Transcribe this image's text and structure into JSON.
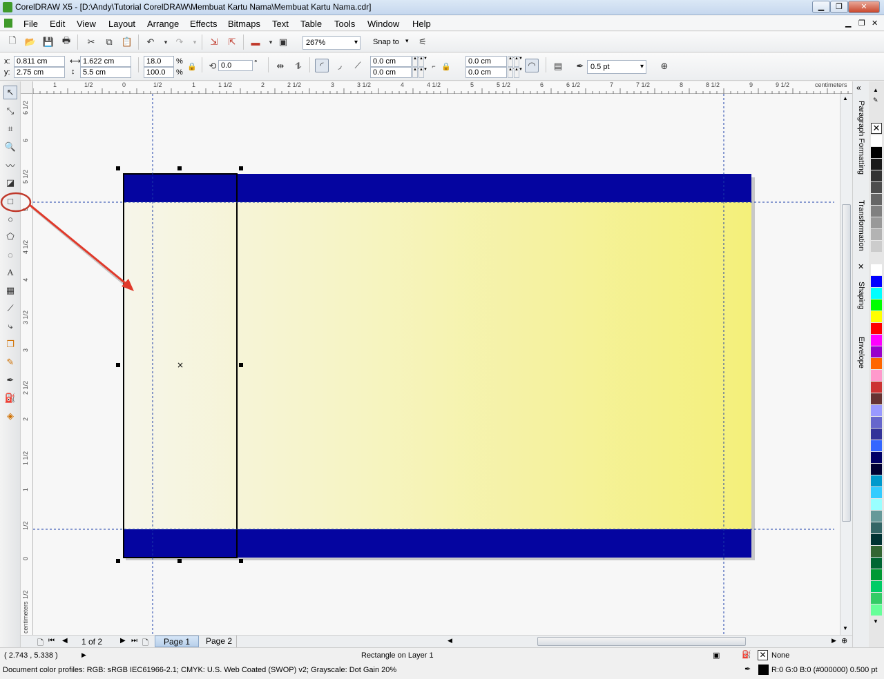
{
  "window": {
    "title": "CorelDRAW X5 - [D:\\Andy\\Tutorial CorelDRAW\\Membuat Kartu Nama\\Membuat Kartu Nama.cdr]"
  },
  "menu": [
    "File",
    "Edit",
    "View",
    "Layout",
    "Arrange",
    "Effects",
    "Bitmaps",
    "Text",
    "Table",
    "Tools",
    "Window",
    "Help"
  ],
  "standard_toolbar": {
    "zoom": "267%",
    "snap_to": "Snap to"
  },
  "property_bar": {
    "x_label": "x:",
    "x": "0.811 cm",
    "y_label": "y:",
    "y": "2.75 cm",
    "width": "1.622 cm",
    "height": "5.5 cm",
    "scale_x": "18.0",
    "scale_y": "100.0",
    "percent": "%",
    "rotation": "0.0",
    "degree": "°",
    "corner_tl": "0.0 cm",
    "corner_bl": "0.0 cm",
    "corner_tr": "0.0 cm",
    "corner_br": "0.0 cm",
    "outline_width": "0.5 pt"
  },
  "rulers": {
    "unit": "centimeters",
    "h_ticks": [
      "1",
      "1/2",
      "0",
      "1/2",
      "1",
      "1 1/2",
      "2",
      "2 1/2",
      "3",
      "3 1/2",
      "4",
      "4 1/2",
      "5",
      "5 1/2",
      "6",
      "6 1/2",
      "7",
      "7 1/2",
      "8",
      "8 1/2",
      "9",
      "9 1/2"
    ],
    "v_ticks": [
      "6 1/2",
      "6",
      "5 1/2",
      "5",
      "4 1/2",
      "4",
      "3 1/2",
      "3",
      "2 1/2",
      "2",
      "1 1/2",
      "1",
      "1/2",
      "0",
      "1/2"
    ],
    "v_unit": "centimeters"
  },
  "dockers": [
    "Paragraph Formatting",
    "Transformation",
    "Shaping",
    "Envelope"
  ],
  "palette": [
    "#ffffff",
    "#000000",
    "#1a1a1a",
    "#333333",
    "#4d4d4d",
    "#666666",
    "#808080",
    "#999999",
    "#b3b3b3",
    "#cccccc",
    "#e6e6e6",
    "#ffffff",
    "#0000ff",
    "#00ffff",
    "#00ff00",
    "#ffff00",
    "#ff0000",
    "#ff00ff",
    "#9900cc",
    "#ff6600",
    "#ff99cc",
    "#cc3333",
    "#663333",
    "#9999ff",
    "#6666cc",
    "#333399",
    "#3366ff",
    "#000066",
    "#000033",
    "#0099cc",
    "#33ccff",
    "#99ffff",
    "#669999",
    "#336666",
    "#003333",
    "#336633",
    "#006633",
    "#009933",
    "#00cc66",
    "#33cc66",
    "#66ff99"
  ],
  "pages": {
    "current": "1 of 2",
    "tabs": [
      "Page 1",
      "Page 2"
    ]
  },
  "status": {
    "coords": "( 2.743 , 5.338 )",
    "object": "Rectangle on Layer 1",
    "fill": "None",
    "color_profiles": "Document color profiles: RGB: sRGB IEC61966-2.1; CMYK: U.S. Web Coated (SWOP) v2; Grayscale: Dot Gain 20%",
    "outline": "R:0 G:0 B:0 (#000000) 0.500 pt"
  }
}
